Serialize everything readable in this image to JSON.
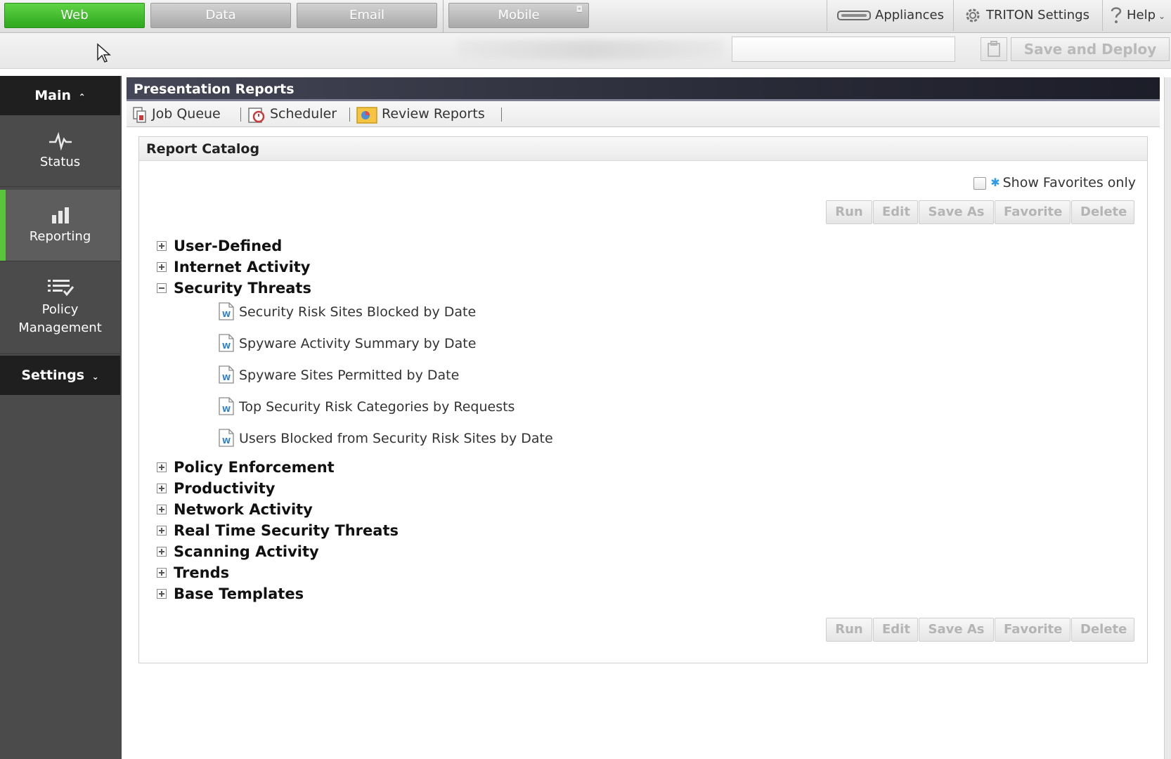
{
  "modules": {
    "tabs": [
      {
        "label": "Web",
        "active": true
      },
      {
        "label": "Data",
        "active": false
      },
      {
        "label": "Email",
        "active": false
      },
      {
        "label": "Mobile",
        "active": false
      }
    ],
    "mobile_badge": "◘"
  },
  "top_right": {
    "appliances": "Appliances",
    "triton_settings": "TRITON Settings",
    "help": "Help"
  },
  "toolbar": {
    "save_deploy": "Save and Deploy"
  },
  "sidebar": {
    "main_header": "Main",
    "items": [
      {
        "label": "Status",
        "icon": "status-pulse-icon"
      },
      {
        "label": "Reporting",
        "icon": "bar-chart-icon",
        "active": true
      },
      {
        "label_line1": "Policy",
        "label_line2": "Management",
        "icon": "policy-list-icon"
      }
    ],
    "settings_header": "Settings"
  },
  "panel": {
    "title": "Presentation Reports",
    "subtabs": [
      "Job Queue",
      "Scheduler",
      "Review Reports"
    ]
  },
  "catalog": {
    "title": "Report Catalog",
    "show_favorites": "Show Favorites only",
    "buttons": [
      "Run",
      "Edit",
      "Save As",
      "Favorite",
      "Delete"
    ],
    "groups_before": [
      "User-Defined",
      "Internet Activity"
    ],
    "expanded_group": "Security Threats",
    "expanded_reports": [
      "Security Risk Sites Blocked by Date",
      "Spyware Activity Summary by Date",
      "Spyware Sites Permitted by Date",
      "Top Security Risk Categories by Requests",
      "Users Blocked from Security Risk Sites by Date"
    ],
    "groups_after": [
      "Policy Enforcement",
      "Productivity",
      "Network Activity",
      "Real Time Security Threats",
      "Scanning Activity",
      "Trends",
      "Base Templates"
    ]
  },
  "colors": {
    "active_module": "#3cb52a",
    "sidebar_bg": "#4b4b4b",
    "panel_title_bg": "#2a2b38",
    "favorite_star": "#2f9be6"
  }
}
